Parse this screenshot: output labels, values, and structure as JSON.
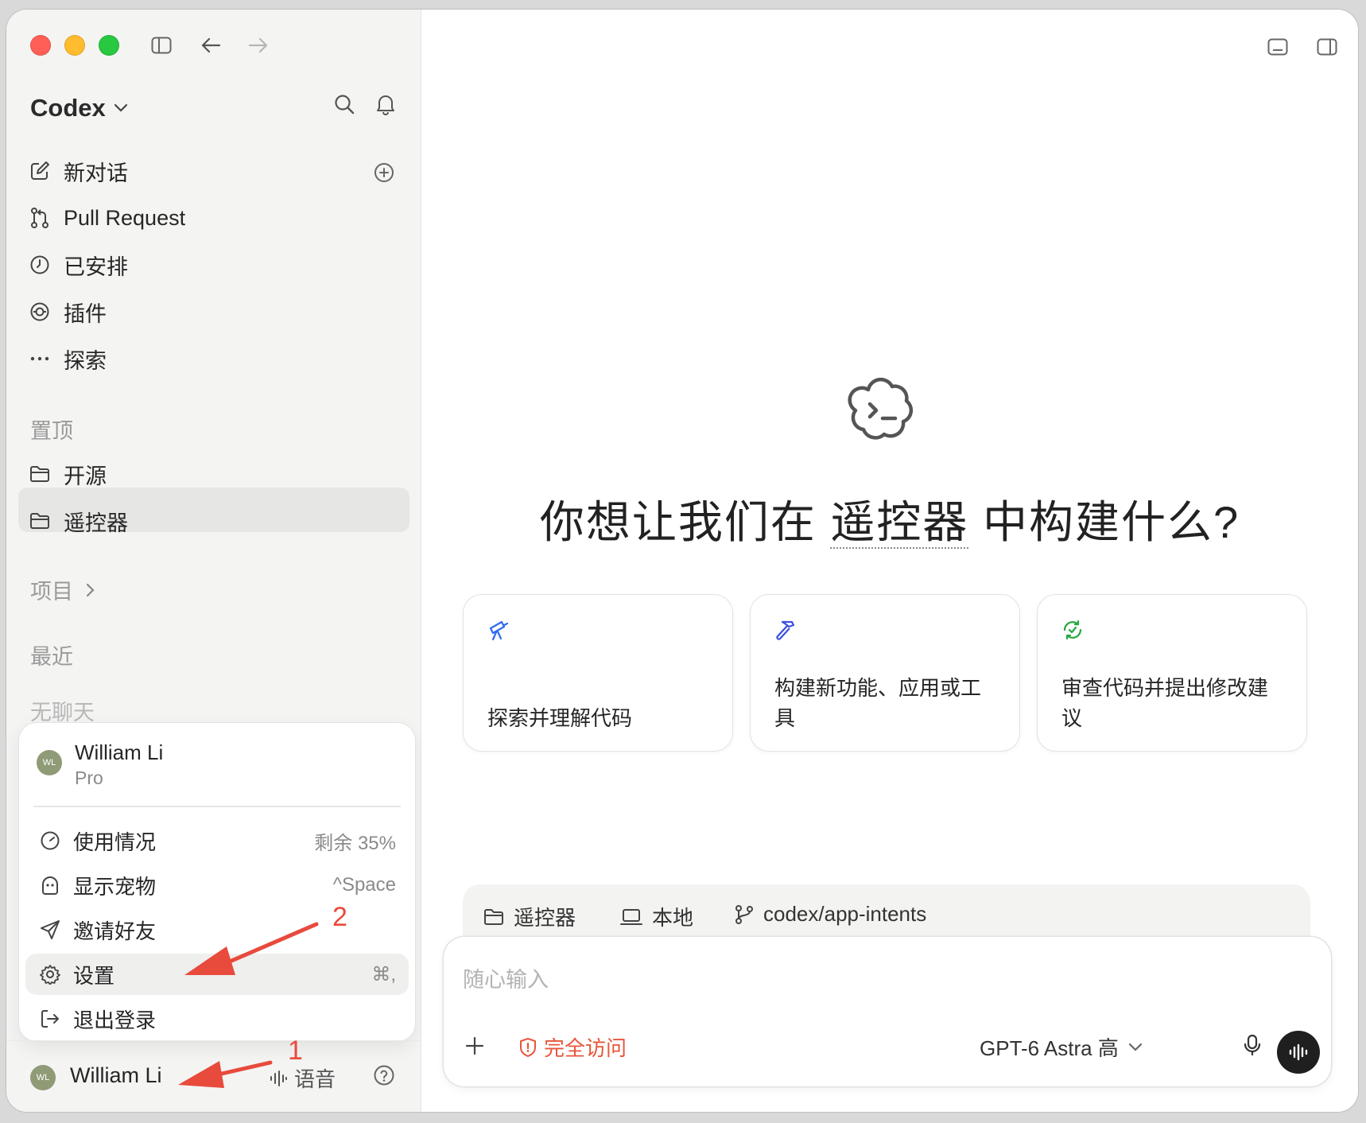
{
  "app": {
    "brand": "Codex"
  },
  "sidebar": {
    "nav": [
      {
        "label": "新对话",
        "icon": "compose-icon"
      },
      {
        "label": "Pull Request",
        "icon": "pull-request-icon"
      },
      {
        "label": "已安排",
        "icon": "clock-icon"
      },
      {
        "label": "插件",
        "icon": "plugin-icon"
      },
      {
        "label": "探索",
        "icon": "more-icon"
      }
    ],
    "pinned_label": "置顶",
    "pinned": [
      {
        "label": "开源",
        "icon": "folder-icon"
      },
      {
        "label": "遥控器",
        "icon": "folder-icon"
      }
    ],
    "projects_label": "项目",
    "recent_label": "最近",
    "no_chats": "无聊天"
  },
  "account_menu": {
    "avatar_initials": "WL",
    "name": "William Li",
    "plan": "Pro",
    "items": [
      {
        "label": "使用情况",
        "right": "剩余 35%",
        "icon": "gauge-icon"
      },
      {
        "label": "显示宠物",
        "right": "^Space",
        "icon": "pet-icon"
      },
      {
        "label": "邀请好友",
        "right": "",
        "icon": "send-icon"
      },
      {
        "label": "设置",
        "right": "⌘,",
        "icon": "gear-icon"
      },
      {
        "label": "退出登录",
        "right": "",
        "icon": "logout-icon"
      }
    ]
  },
  "footer": {
    "avatar_initials": "WL",
    "user": "William Li",
    "voice": "语音"
  },
  "main": {
    "headline_pre": "你想让我们在 ",
    "headline_project": "遥控器",
    "headline_post": " 中构建什么?",
    "cards": [
      {
        "text": "探索并理解代码",
        "icon": "telescope-icon",
        "color": "#2f6bf0"
      },
      {
        "text": "构建新功能、应用或工具",
        "icon": "hammer-icon",
        "color": "#3b4fe0"
      },
      {
        "text": "审查代码并提出修改建议",
        "icon": "review-icon",
        "color": "#27a843"
      }
    ],
    "context": {
      "project": "遥控器",
      "env": "本地",
      "branch": "codex/app-intents"
    },
    "composer": {
      "placeholder": "随心输入",
      "access": "完全访问",
      "model": "GPT-6 Astra 高"
    }
  },
  "annotations": {
    "n1": "1",
    "n2": "2",
    "color": "#e84a3c"
  }
}
